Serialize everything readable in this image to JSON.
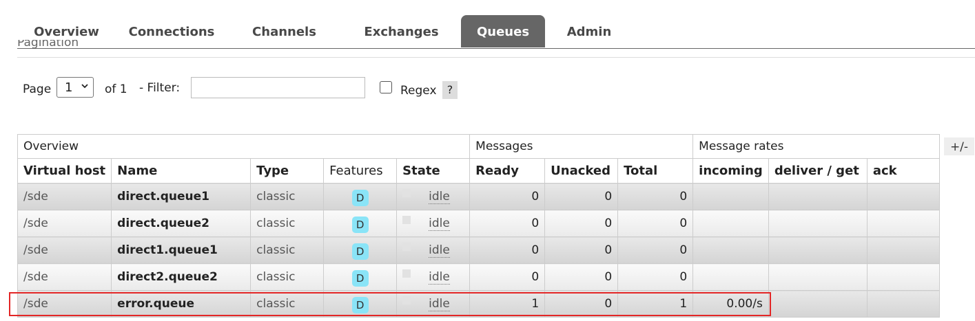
{
  "nav": {
    "tabs": [
      {
        "label": "Overview"
      },
      {
        "label": "Connections"
      },
      {
        "label": "Channels"
      },
      {
        "label": "Exchanges"
      },
      {
        "label": "Queues",
        "active": true
      },
      {
        "label": "Admin"
      }
    ]
  },
  "pagination": {
    "legend": "Pagination",
    "page_label": "Page",
    "page_value": "1",
    "of_label": "of 1",
    "filter_label": "- Filter:",
    "filter_value": "",
    "regex_label": "Regex",
    "regex_checked": false,
    "help_label": "?"
  },
  "columns_toggle": "+/-",
  "table": {
    "groups": [
      "Overview",
      "Messages",
      "Message rates"
    ],
    "headers": [
      "Virtual host",
      "Name",
      "Type",
      "Features",
      "State",
      "Ready",
      "Unacked",
      "Total",
      "incoming",
      "deliver / get",
      "ack"
    ],
    "rows": [
      {
        "vhost": "/sde",
        "name": "direct.queue1",
        "type": "classic",
        "feature": "D",
        "state": "idle",
        "ready": "0",
        "unacked": "0",
        "total": "0",
        "incoming": "",
        "deliver": "",
        "ack": ""
      },
      {
        "vhost": "/sde",
        "name": "direct.queue2",
        "type": "classic",
        "feature": "D",
        "state": "idle",
        "ready": "0",
        "unacked": "0",
        "total": "0",
        "incoming": "",
        "deliver": "",
        "ack": ""
      },
      {
        "vhost": "/sde",
        "name": "direct1.queue1",
        "type": "classic",
        "feature": "D",
        "state": "idle",
        "ready": "0",
        "unacked": "0",
        "total": "0",
        "incoming": "",
        "deliver": "",
        "ack": ""
      },
      {
        "vhost": "/sde",
        "name": "direct2.queue2",
        "type": "classic",
        "feature": "D",
        "state": "idle",
        "ready": "0",
        "unacked": "0",
        "total": "0",
        "incoming": "",
        "deliver": "",
        "ack": ""
      },
      {
        "vhost": "/sde",
        "name": "error.queue",
        "type": "classic",
        "feature": "D",
        "state": "idle",
        "ready": "1",
        "unacked": "0",
        "total": "1",
        "incoming": "0.00/s",
        "deliver": "",
        "ack": ""
      }
    ]
  },
  "colors": {
    "active_tab": "#666666",
    "feature_badge": "#8ae4f7",
    "highlight_box": "#e32626"
  }
}
